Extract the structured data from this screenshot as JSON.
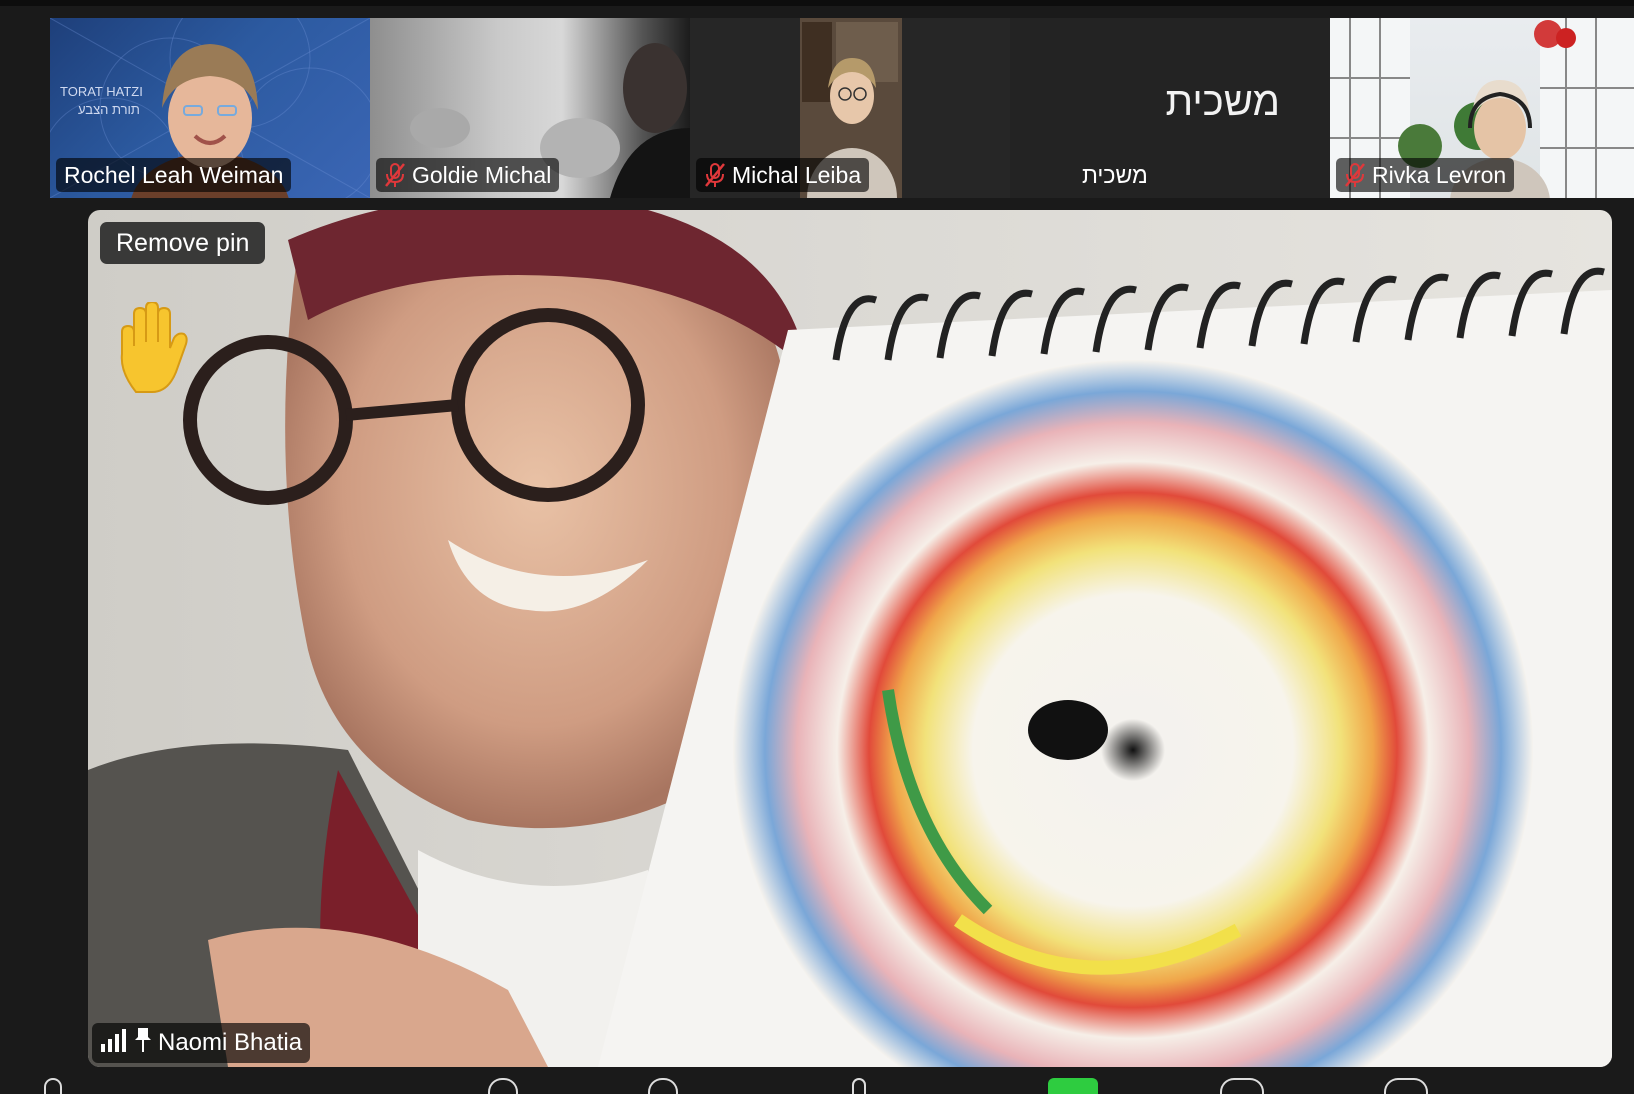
{
  "participants": [
    {
      "name": "Rochel Leah Weiman",
      "muted": false,
      "bg_text_en": "TORAT HATZI",
      "bg_text_he": "תורת הצבע"
    },
    {
      "name": "Goldie Michal",
      "muted": true
    },
    {
      "name": "Michal Leiba",
      "muted": true
    },
    {
      "name": "משכית",
      "display_text": "משכית",
      "muted": false
    },
    {
      "name": "Rivka Levron",
      "muted": true
    }
  ],
  "pinned": {
    "name": "Naomi Bhatia",
    "remove_pin_label": "Remove pin",
    "reaction": "raised-hand"
  },
  "colors": {
    "background": "#1a1a1a",
    "badge_bg": "#000000",
    "mic_off_red": "#e0383b",
    "bottom_green": "#2ecc40"
  }
}
